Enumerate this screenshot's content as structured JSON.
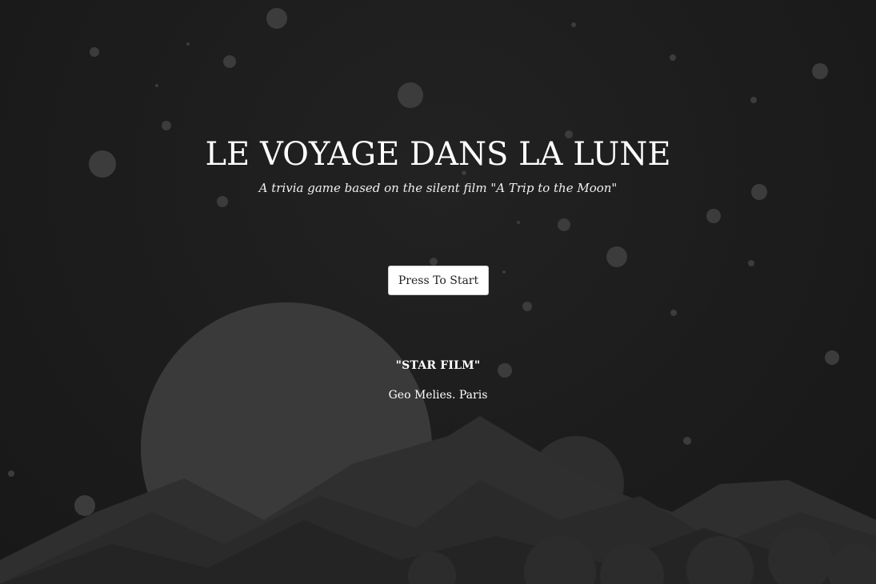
{
  "game": {
    "title": "LE VOYAGE DANS LA LUNE",
    "subtitle": "A trivia game based on the silent film \"A Trip to the Moon\"",
    "start_label": "Press To Start"
  },
  "credits": {
    "studio": "\"STAR FILM\"",
    "maker": "Geo Melies. Paris"
  },
  "colors": {
    "background": "#1b1b1b",
    "text": "#ffffff",
    "moon": "#3a3a3a",
    "mountains_far": "#2f2f2f",
    "mountains_near": "#262626",
    "stars": "#3c3c3c"
  }
}
